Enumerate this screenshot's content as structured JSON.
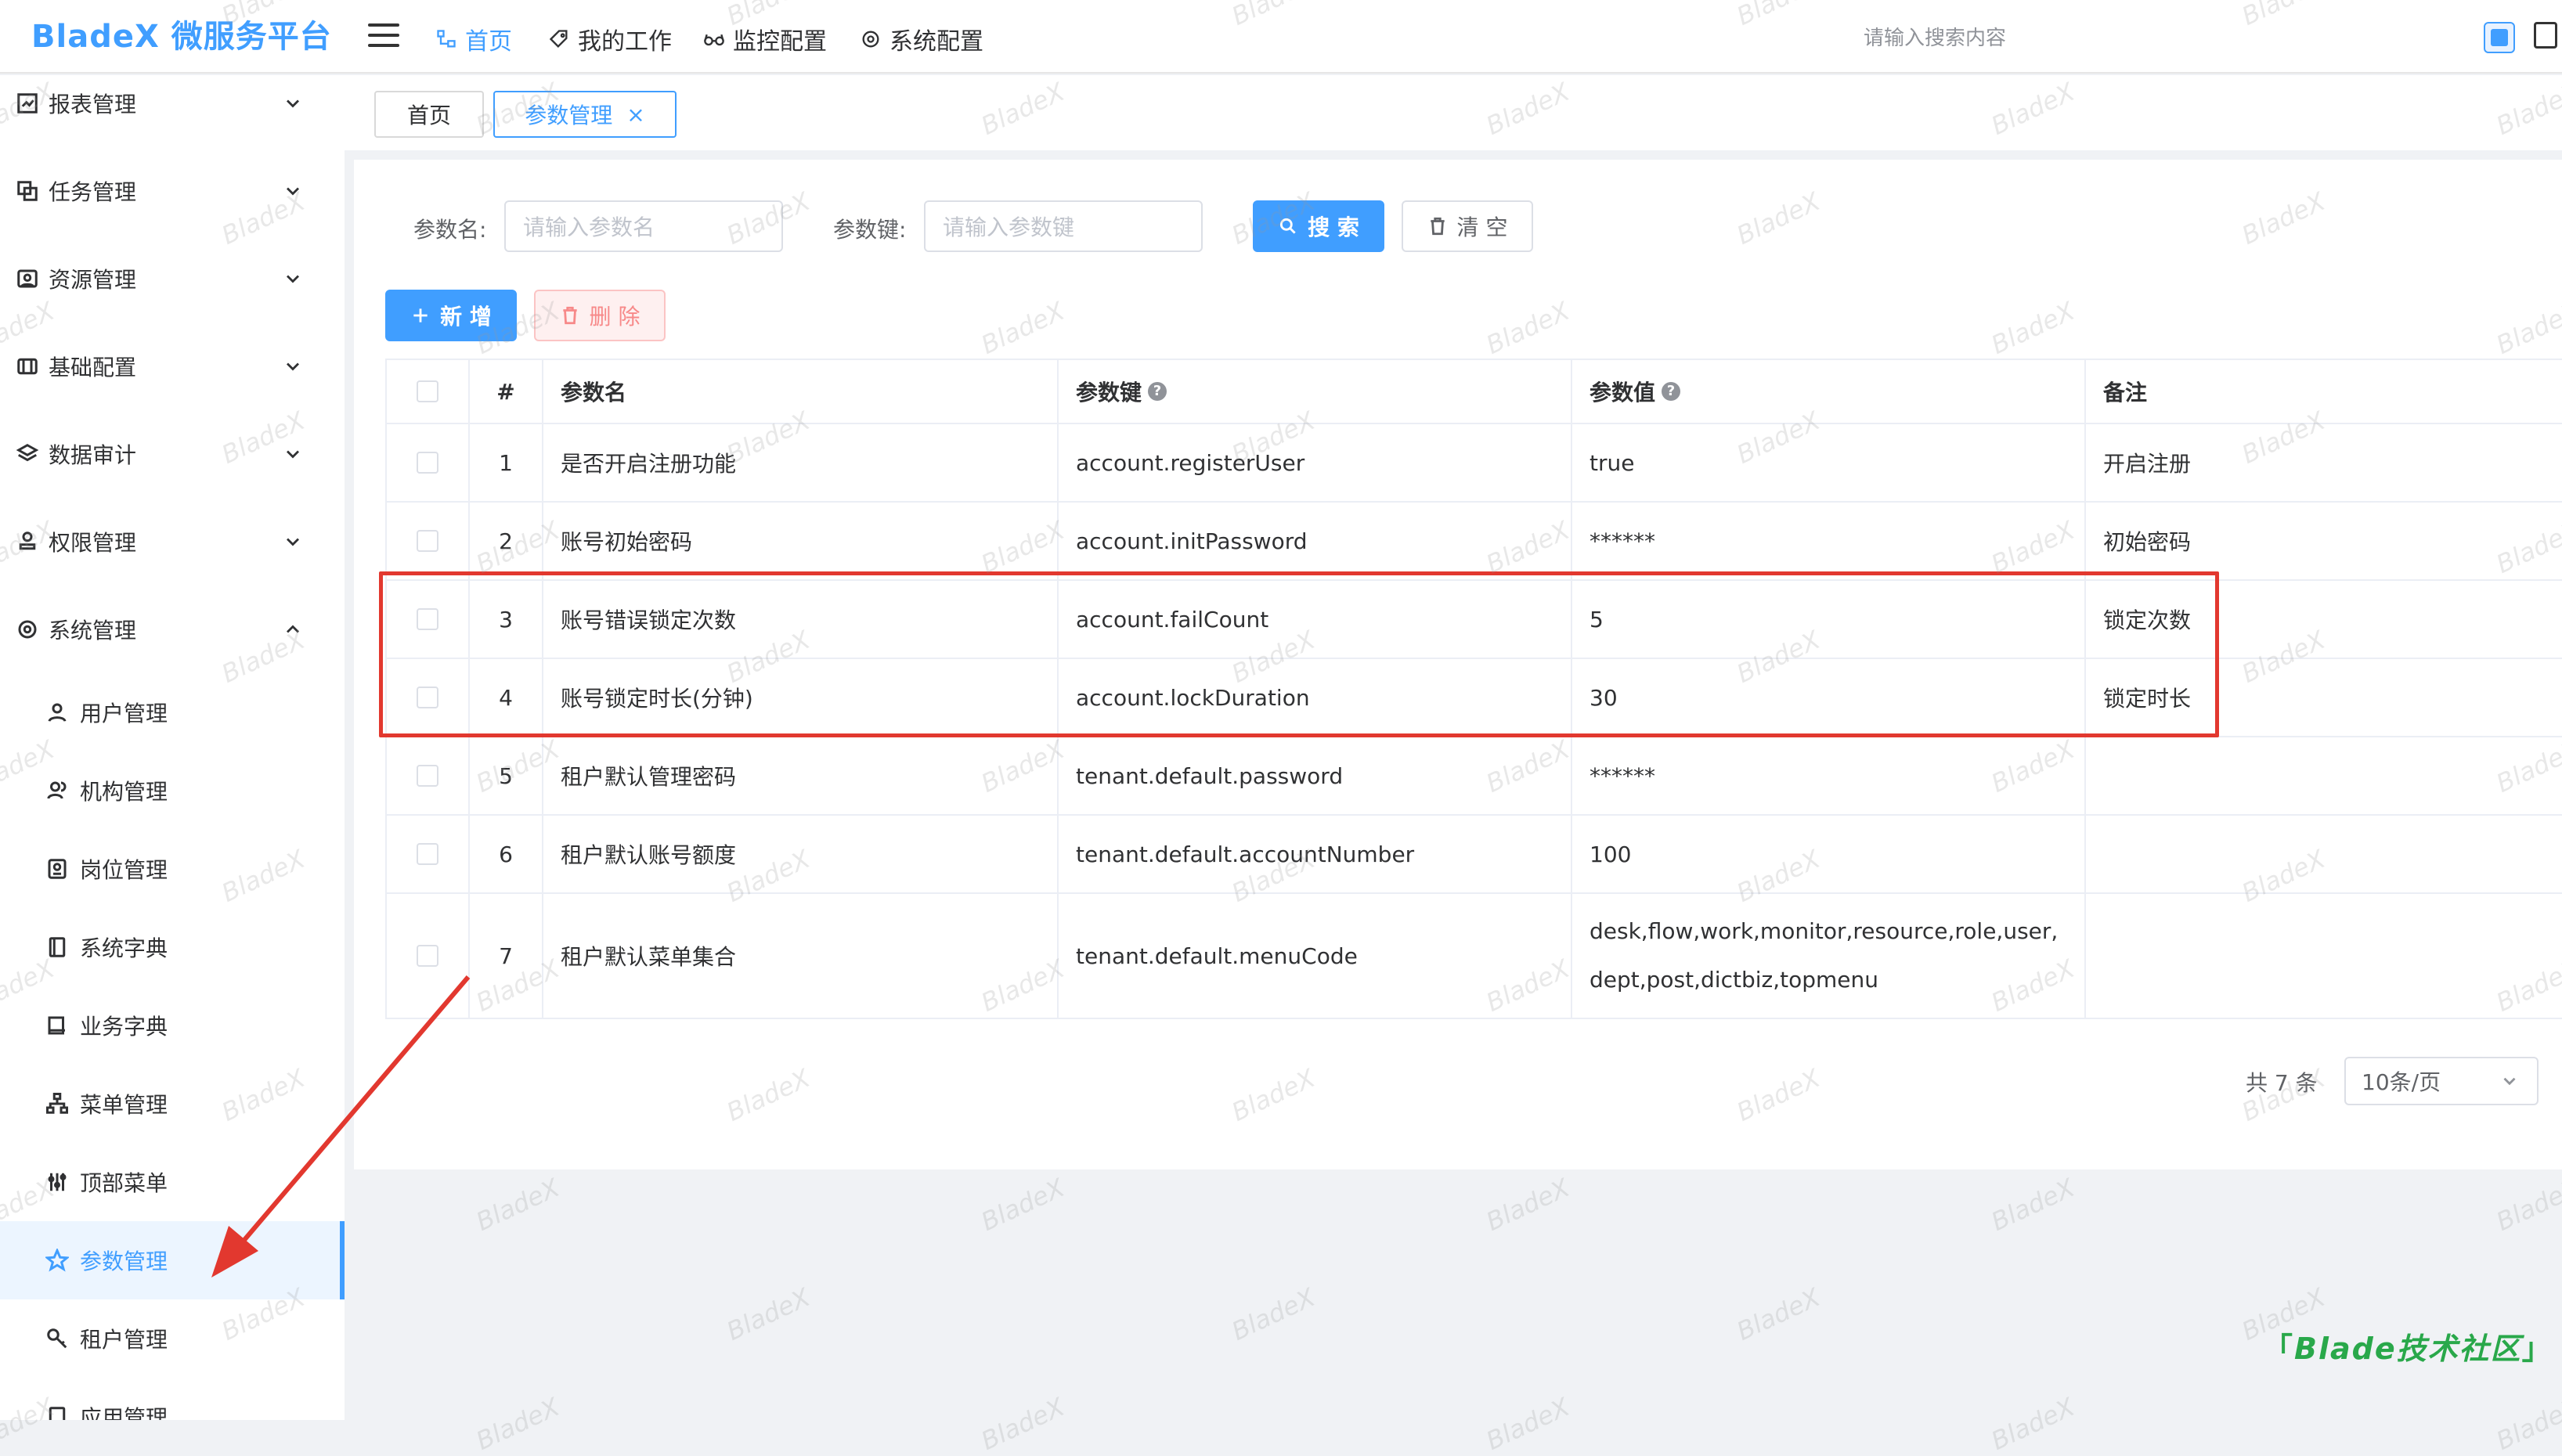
{
  "app": {
    "title": "BladeX 微服务平台"
  },
  "header": {
    "nav": [
      {
        "label": "首页",
        "icon": "sitemap-icon",
        "active": true
      },
      {
        "label": "我的工作",
        "icon": "tag-icon"
      },
      {
        "label": "监控配置",
        "icon": "glasses-icon"
      },
      {
        "label": "系统配置",
        "icon": "gear-icon"
      }
    ],
    "search_placeholder": "请输入搜索内容"
  },
  "sidebar": {
    "menus": [
      {
        "label": "报表管理",
        "icon": "chart-icon"
      },
      {
        "label": "任务管理",
        "icon": "task-icon"
      },
      {
        "label": "资源管理",
        "icon": "resource-icon"
      },
      {
        "label": "基础配置",
        "icon": "config-icon"
      },
      {
        "label": "数据审计",
        "icon": "layers-icon"
      },
      {
        "label": "权限管理",
        "icon": "stamp-icon"
      },
      {
        "label": "系统管理",
        "icon": "gear-icon",
        "expanded": true
      }
    ],
    "sub_items": [
      {
        "label": "用户管理",
        "icon": "user-icon"
      },
      {
        "label": "机构管理",
        "icon": "org-icon"
      },
      {
        "label": "岗位管理",
        "icon": "badge-icon"
      },
      {
        "label": "系统字典",
        "icon": "dict-icon"
      },
      {
        "label": "业务字典",
        "icon": "book-icon"
      },
      {
        "label": "菜单管理",
        "icon": "tree-icon"
      },
      {
        "label": "顶部菜单",
        "icon": "sliders-icon"
      },
      {
        "label": "参数管理",
        "icon": "star-icon",
        "active": true
      },
      {
        "label": "租户管理",
        "icon": "key-icon"
      },
      {
        "label": "应用管理",
        "icon": "app-icon"
      }
    ]
  },
  "tabs": [
    {
      "label": "首页"
    },
    {
      "label": "参数管理",
      "active": true,
      "close": "×"
    }
  ],
  "search_form": {
    "param_name_label": "参数名:",
    "param_name_placeholder": "请输入参数名",
    "param_key_label": "参数键:",
    "param_key_placeholder": "请输入参数键",
    "search_button": "搜 索",
    "clear_button": "清 空"
  },
  "toolbar": {
    "add_button": "新 增",
    "delete_button": "删 除"
  },
  "table": {
    "columns": [
      "#",
      "参数名",
      "参数键",
      "参数值",
      "备注"
    ],
    "help_mark": "?",
    "rows": [
      {
        "index": "1",
        "name": "是否开启注册功能",
        "key": "account.registerUser",
        "value": "true",
        "remark": "开启注册"
      },
      {
        "index": "2",
        "name": "账号初始密码",
        "key": "account.initPassword",
        "value": "******",
        "remark": "初始密码"
      },
      {
        "index": "3",
        "name": "账号错误锁定次数",
        "key": "account.failCount",
        "value": "5",
        "remark": "锁定次数"
      },
      {
        "index": "4",
        "name": "账号锁定时长(分钟)",
        "key": "account.lockDuration",
        "value": "30",
        "remark": "锁定时长"
      },
      {
        "index": "5",
        "name": "租户默认管理密码",
        "key": "tenant.default.password",
        "value": "******",
        "remark": ""
      },
      {
        "index": "6",
        "name": "租户默认账号额度",
        "key": "tenant.default.accountNumber",
        "value": "100",
        "remark": ""
      },
      {
        "index": "7",
        "name": "租户默认菜单集合",
        "key": "tenant.default.menuCode",
        "value": "desk,flow,work,monitor,resource,role,user,dept,post,dictbiz,topmenu",
        "remark": ""
      }
    ]
  },
  "pagination": {
    "total": "共 7 条",
    "page_size": "10条/页"
  },
  "watermark": "BladeX",
  "community_badge": "Blade技术社区",
  "colors": {
    "primary": "#409eff",
    "danger": "#f56c6c",
    "highlight": "#e2382f",
    "badge": "#29a84a"
  }
}
